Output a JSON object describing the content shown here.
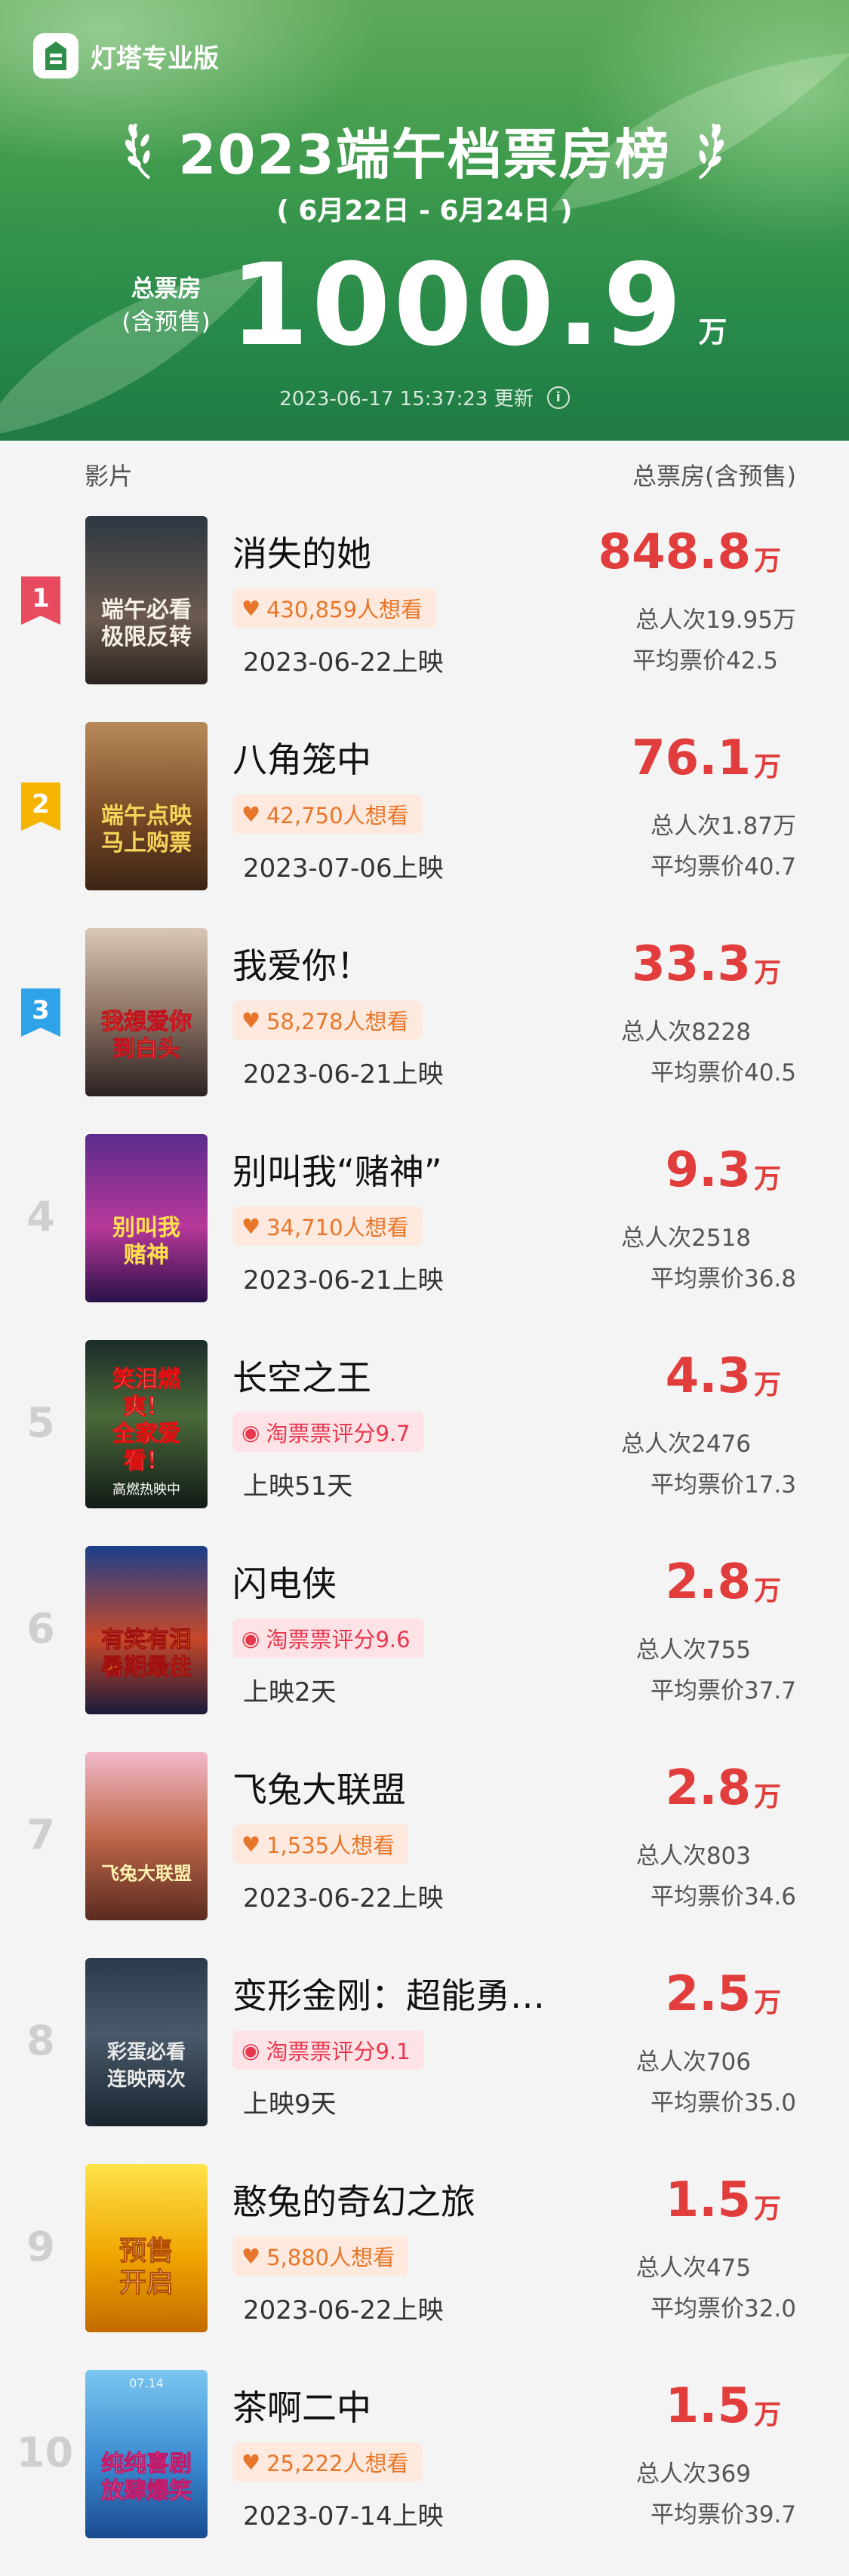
{
  "app": {
    "name": "灯塔专业版"
  },
  "header": {
    "title": "2023端午档票房榜",
    "date_range": "( 6月22日 - 6月24日 )",
    "total_label_line1": "总票房",
    "total_label_line2": "(含预售)",
    "total_value": "1000.9",
    "total_unit": "万",
    "updated": "2023-06-17 15:37:23 更新",
    "info_icon_glyph": "i"
  },
  "list_header": {
    "film": "影片",
    "box_office": "总票房(含预售)"
  },
  "colors": {
    "accent_red": "#e23d3d",
    "rank1": "#e84a5f",
    "rank2": "#f5b400",
    "rank3": "#2ea3e8",
    "header_green": "#2f8f4a"
  },
  "movies": [
    {
      "rank": "1",
      "title": "消失的她",
      "tag_type": "want",
      "tag_icon": "heart-icon",
      "tag": "430,859人想看",
      "release": "2023-06-22上映",
      "box_office": "848.8",
      "unit": "万",
      "viewers": "总人次19.95万",
      "avg_price": "平均票价42.5",
      "poster_text": "端午必看\n极限反转",
      "poster_sub": ""
    },
    {
      "rank": "2",
      "title": "八角笼中",
      "tag_type": "want",
      "tag_icon": "heart-icon",
      "tag": "42,750人想看",
      "release": "2023-07-06上映",
      "box_office": "76.1",
      "unit": "万",
      "viewers": "总人次1.87万",
      "avg_price": "平均票价40.7",
      "poster_text": "端午点映\n马上购票",
      "poster_sub": ""
    },
    {
      "rank": "3",
      "title": "我爱你！",
      "tag_type": "want",
      "tag_icon": "heart-icon",
      "tag": "58,278人想看",
      "release": "2023-06-21上映",
      "box_office": "33.3",
      "unit": "万",
      "viewers": "总人次8228",
      "avg_price": "平均票价40.5",
      "poster_text": "我想爱你\n到白头",
      "poster_sub": ""
    },
    {
      "rank": "4",
      "title": "别叫我“赌神”",
      "tag_type": "want",
      "tag_icon": "heart-icon",
      "tag": "34,710人想看",
      "release": "2023-06-21上映",
      "box_office": "9.3",
      "unit": "万",
      "viewers": "总人次2518",
      "avg_price": "平均票价36.8",
      "poster_text": "别叫我\n赌神",
      "poster_sub": ""
    },
    {
      "rank": "5",
      "title": "长空之王",
      "tag_type": "score",
      "tag_icon": "taopiaopiao-icon",
      "tag": "淘票票评分9.7",
      "release": "上映51天",
      "box_office": "4.3",
      "unit": "万",
      "viewers": "总人次2476",
      "avg_price": "平均票价17.3",
      "poster_text": "笑泪燃爽！\n全家爱看！",
      "poster_sub": "高燃热映中"
    },
    {
      "rank": "6",
      "title": "闪电侠",
      "tag_type": "score",
      "tag_icon": "taopiaopiao-icon",
      "tag": "淘票票评分9.6",
      "release": "上映2天",
      "box_office": "2.8",
      "unit": "万",
      "viewers": "总人次755",
      "avg_price": "平均票价37.7",
      "poster_text": "有笑有泪\n暑期最佳",
      "poster_sub": ""
    },
    {
      "rank": "7",
      "title": "飞兔大联盟",
      "tag_type": "want",
      "tag_icon": "heart-icon",
      "tag": "1,535人想看",
      "release": "2023-06-22上映",
      "box_office": "2.8",
      "unit": "万",
      "viewers": "总人次803",
      "avg_price": "平均票价34.6",
      "poster_text": "飞兔大联盟",
      "poster_sub": ""
    },
    {
      "rank": "8",
      "title": "变形金刚：超能勇…",
      "tag_type": "score",
      "tag_icon": "taopiaopiao-icon",
      "tag": "淘票票评分9.1",
      "release": "上映9天",
      "box_office": "2.5",
      "unit": "万",
      "viewers": "总人次706",
      "avg_price": "平均票价35.0",
      "poster_text": "彩蛋必看\n连映两次",
      "poster_sub": ""
    },
    {
      "rank": "9",
      "title": "憨兔的奇幻之旅",
      "tag_type": "want",
      "tag_icon": "heart-icon",
      "tag": "5,880人想看",
      "release": "2023-06-22上映",
      "box_office": "1.5",
      "unit": "万",
      "viewers": "总人次475",
      "avg_price": "平均票价32.0",
      "poster_text": "预售\n开启",
      "poster_sub": ""
    },
    {
      "rank": "10",
      "title": "茶啊二中",
      "tag_type": "want",
      "tag_icon": "heart-icon",
      "tag": "25,222人想看",
      "release": "2023-07-14上映",
      "box_office": "1.5",
      "unit": "万",
      "viewers": "总人次369",
      "avg_price": "平均票价39.7",
      "poster_text": "纯纯喜剧\n放肆爆笑",
      "poster_sub": "07.14"
    }
  ]
}
